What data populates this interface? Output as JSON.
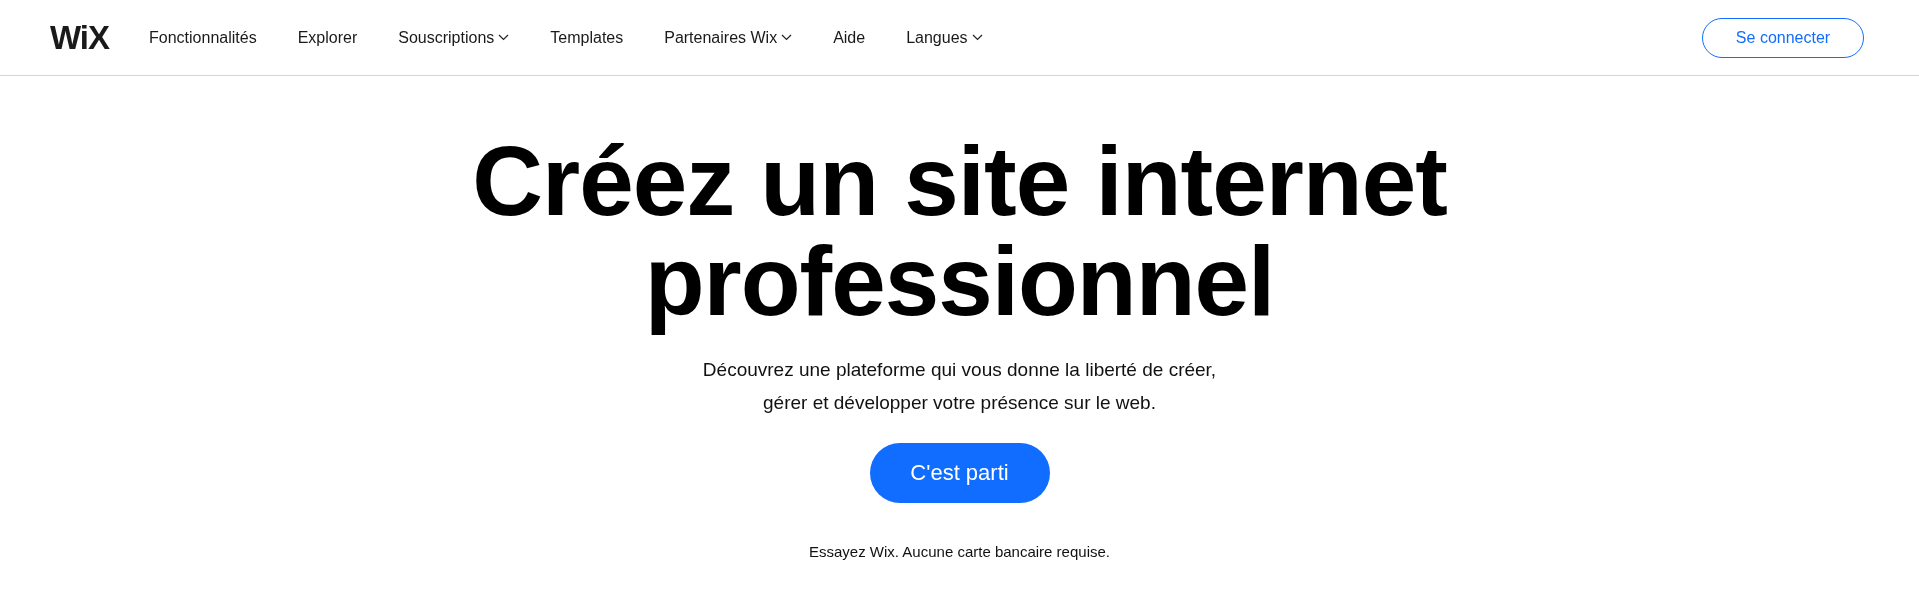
{
  "header": {
    "logo": "WiX",
    "nav": [
      {
        "label": "Fonctionnalités",
        "has_menu": false
      },
      {
        "label": "Explorer",
        "has_menu": false
      },
      {
        "label": "Souscriptions",
        "has_menu": true
      },
      {
        "label": "Templates",
        "has_menu": false
      },
      {
        "label": "Partenaires Wix",
        "has_menu": true
      },
      {
        "label": "Aide",
        "has_menu": false
      },
      {
        "label": "Langues",
        "has_menu": true
      }
    ],
    "login_button": "Se connecter"
  },
  "hero": {
    "headline": [
      "Créez un site internet",
      "professionnel"
    ],
    "subtitle": [
      "Découvrez une plateforme qui vous donne la liberté de créer,",
      "gérer et développer votre présence sur le web."
    ],
    "cta_button": "C'est parti",
    "note": "Essayez Wix. Aucune carte bancaire requise."
  }
}
